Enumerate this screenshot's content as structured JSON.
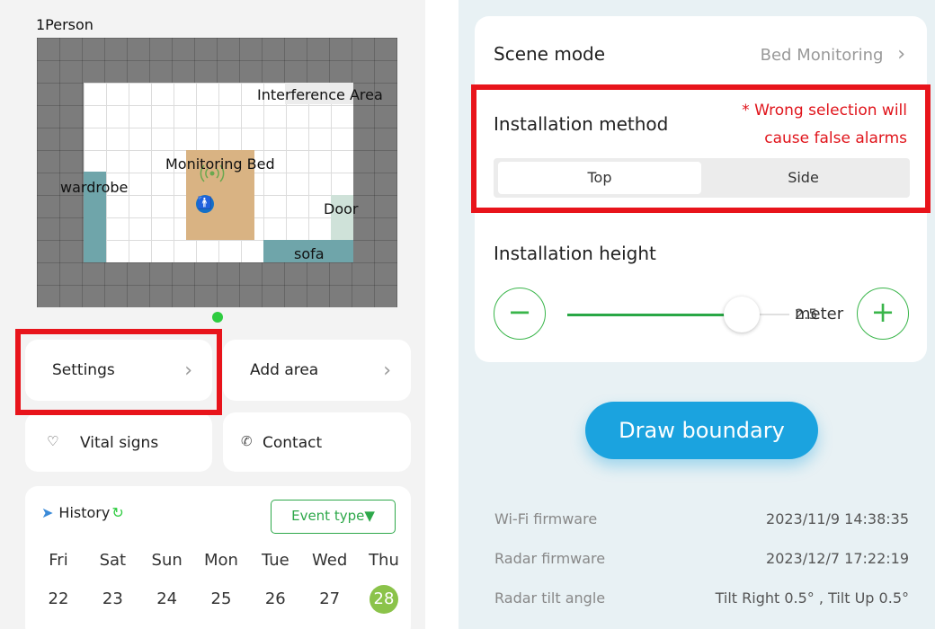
{
  "left": {
    "person_count": "1Person",
    "zones": {
      "interference": "Interference Area",
      "monitoring_bed": "Monitoring Bed",
      "wardrobe": "wardrobe",
      "door": "Door",
      "sofa": "sofa"
    },
    "settings_label": "Settings",
    "add_area_label": "Add area",
    "vital_signs_label": "Vital signs",
    "contact_label": "Contact",
    "history": {
      "title": "History",
      "event_type_label": "Event type",
      "days": [
        "Fri",
        "Sat",
        "Sun",
        "Mon",
        "Tue",
        "Wed",
        "Thu"
      ],
      "dates": [
        "22",
        "23",
        "24",
        "25",
        "26",
        "27",
        "28"
      ],
      "selected_date": "28"
    }
  },
  "right": {
    "scene_mode_label": "Scene mode",
    "scene_mode_value": "Bed Monitoring",
    "installation_method_label": "Installation method",
    "warning": "* Wrong selection will cause false alarms",
    "method_options": [
      "Top",
      "Side"
    ],
    "method_selected": "Top",
    "installation_height_label": "Installation height",
    "height_value": "2.5",
    "height_unit": "meter",
    "draw_boundary_label": "Draw boundary",
    "info": [
      {
        "key": "Wi-Fi firmware",
        "value": "2023/11/9 14:38:35"
      },
      {
        "key": "Radar firmware",
        "value": "2023/12/7 17:22:19"
      },
      {
        "key": "Radar tilt angle",
        "value": "Tilt Right 0.5° , Tilt Up 0.5°"
      }
    ]
  },
  "colors": {
    "accent_green": "#39b54a",
    "highlight_red": "#e8141b",
    "primary_blue": "#1ba3df"
  }
}
